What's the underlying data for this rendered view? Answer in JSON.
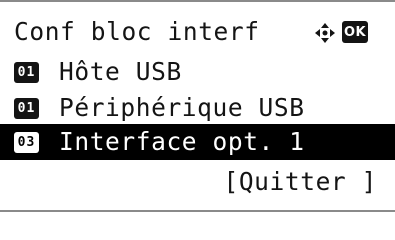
{
  "header": {
    "title": "Conf bloc interf",
    "ok_label": "OK",
    "nav_icon": "four-way-arrow-icon"
  },
  "menu": {
    "items": [
      {
        "number": "01",
        "label": "Hôte USB",
        "selected": false
      },
      {
        "number": "01",
        "label": "Périphérique USB",
        "selected": false
      },
      {
        "number": "03",
        "label": "Interface opt. 1",
        "selected": true
      }
    ]
  },
  "footer": {
    "exit_label": "[Quitter ]"
  },
  "colors": {
    "background": "#ffffff",
    "text": "#141414",
    "highlight": "#000000"
  }
}
